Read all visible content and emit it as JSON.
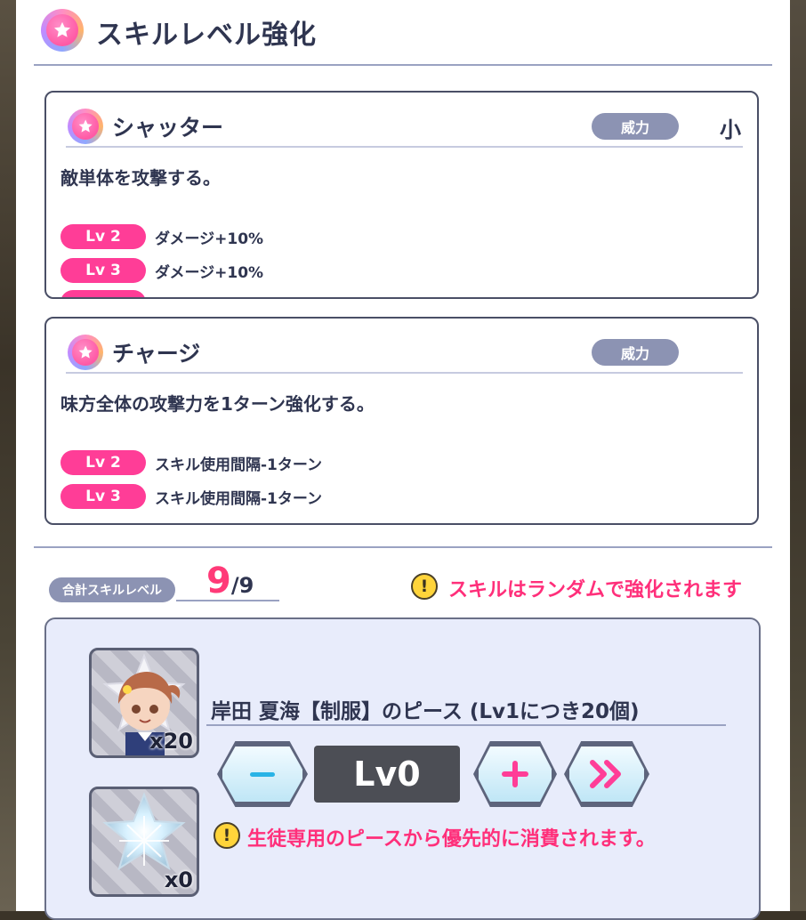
{
  "header": {
    "title": "スキルレベル強化",
    "title_icon": "star-icon"
  },
  "skills": [
    {
      "name": "シャッター",
      "power_label": "威力",
      "power_value": "小",
      "description": "敵単体を攻撃する。",
      "levels": [
        {
          "label": "Lv 2",
          "effect": "ダメージ+10%"
        },
        {
          "label": "Lv 3",
          "effect": "ダメージ+10%"
        }
      ]
    },
    {
      "name": "チャージ",
      "power_label": "威力",
      "description": "味方全体の攻撃力を1ターン強化する。",
      "levels": [
        {
          "label": "Lv 2",
          "effect": "スキル使用間隔-1ターン"
        },
        {
          "label": "Lv 3",
          "effect": "スキル使用間隔-1ターン"
        }
      ]
    }
  ],
  "total": {
    "label": "合計スキルレベル",
    "current": "9",
    "max": "/9"
  },
  "random_notice": "スキルはランダムで強化されます",
  "pieces": {
    "title": "岸田 夏海【制服】のピース (Lv1につき20個)",
    "character_count": "x20",
    "generic_count": "x0",
    "level_display": "Lv0",
    "notice": "生徒専用のピースから優先的に消費されます。"
  },
  "colors": {
    "accent_pink": "#ff3d97",
    "warning_text": "#ff2f7a",
    "pill_gray": "#8c93b3"
  }
}
